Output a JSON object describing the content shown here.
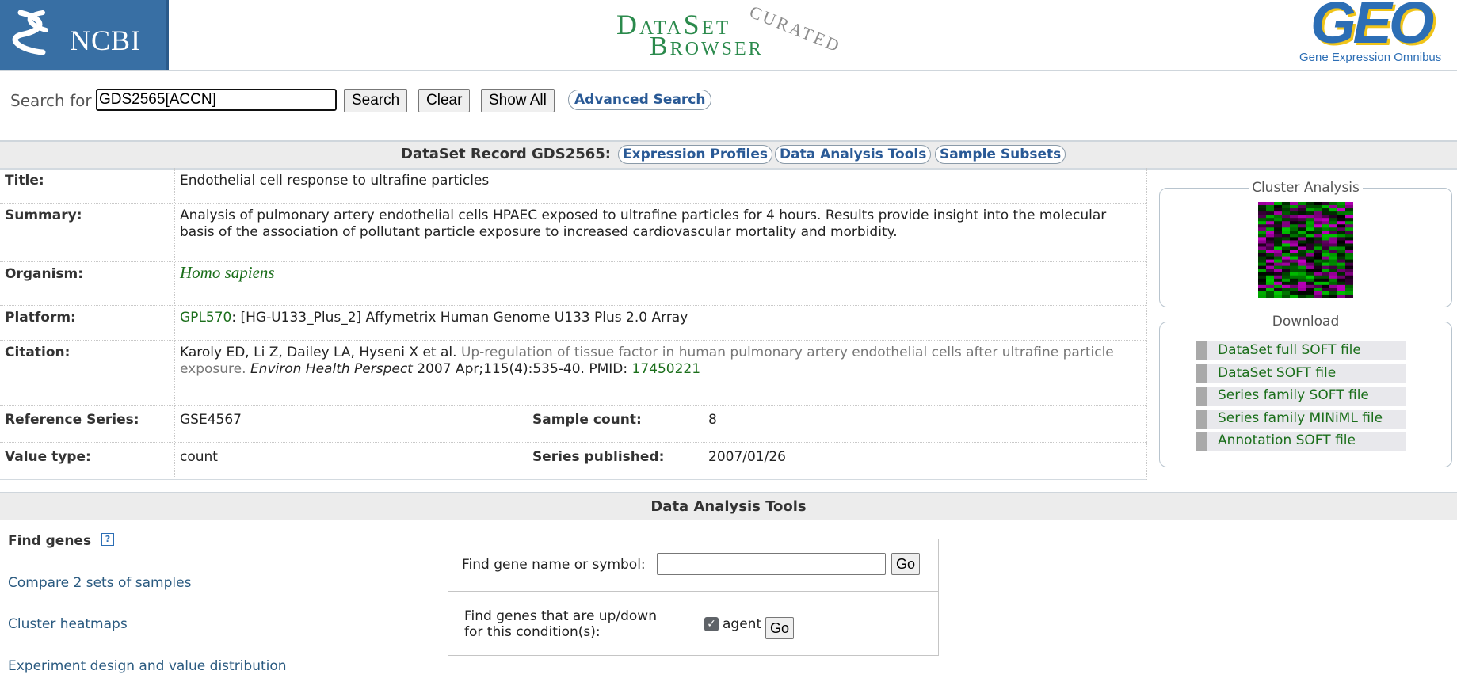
{
  "header": {
    "ncbi_logo": "NCBI",
    "title_line1": "DataSet",
    "title_line2": "Browser",
    "title_stamp": "Curated",
    "geo_logo": "GEO",
    "geo_subtitle": "Gene Expression Omnibus"
  },
  "search": {
    "label": "Search for",
    "value": "GDS2565[ACCN]",
    "search_button": "Search",
    "clear_button": "Clear",
    "show_all_button": "Show All",
    "advanced_link": "Advanced Search"
  },
  "record": {
    "title": "DataSet Record GDS2565:",
    "tabs": [
      {
        "label": "Expression Profiles"
      },
      {
        "label": "Data Analysis Tools"
      },
      {
        "label": "Sample Subsets"
      }
    ],
    "fields": {
      "title_label": "Title:",
      "title_value": "Endothelial cell response to ultrafine particles",
      "summary_label": "Summary:",
      "summary_line1": "Analysis of pulmonary artery endothelial cells HPAEC exposed to ultrafine particles for 4 hours. Results provide insight into the molecular",
      "summary_line2": "basis of the association of pollutant particle exposure to increased cardiovascular mortality and morbidity.",
      "organism_label": "Organism:",
      "organism_value": "Homo sapiens",
      "platform_label": "Platform:",
      "platform_id": "GPL570",
      "platform_desc": ": [HG-U133_Plus_2] Affymetrix Human Genome U133 Plus 2.0 Array",
      "citation_label": "Citation:",
      "citation_authors": "Karoly ED, Li Z, Dailey LA, Hyseni X et al.",
      "citation_title_line1": "Up-regulation of tissue factor in human pulmonary artery endothelial cells after ultrafine particle",
      "citation_title_line2": "exposure.",
      "citation_journal": "Environ Health Perspect",
      "citation_details": "2007 Apr;115(4):535-40. PMID:",
      "citation_pmid": "17450221",
      "reference_series_label": "Reference Series:",
      "reference_series_value": "GSE4567",
      "sample_count_label": "Sample count:",
      "sample_count_value": "8",
      "value_type_label": "Value type:",
      "value_type_value": "count",
      "series_published_label": "Series published:",
      "series_published_value": "2007/01/26"
    }
  },
  "cluster_analysis": {
    "title": "Cluster Analysis"
  },
  "download": {
    "title": "Download",
    "items": [
      {
        "label": "DataSet full SOFT file"
      },
      {
        "label": "DataSet SOFT file"
      },
      {
        "label": "Series family SOFT file"
      },
      {
        "label": "Series family MINiML file"
      },
      {
        "label": "Annotation SOFT file"
      }
    ]
  },
  "tools": {
    "title": "Data Analysis Tools",
    "links": [
      {
        "label": "Find genes"
      },
      {
        "label": "Compare 2 sets of samples"
      },
      {
        "label": "Cluster heatmaps"
      },
      {
        "label": "Experiment design and value distribution"
      }
    ],
    "help_icon": "?",
    "gene_label": "Find gene name or symbol:",
    "gene_input_value": "",
    "go_label": "Go",
    "condition_label_line1": "Find genes that are up/down",
    "condition_label_line2": "for this condition(s):",
    "condition_checkbox_label": "agent",
    "condition_checked": true
  },
  "colors": {
    "ncbi_blue": "#386fa4",
    "link_green": "#1a6e1a",
    "tab_blue": "#2a5a96",
    "geo_blue": "#2c6eb5",
    "geo_yellow": "#f0c419"
  }
}
